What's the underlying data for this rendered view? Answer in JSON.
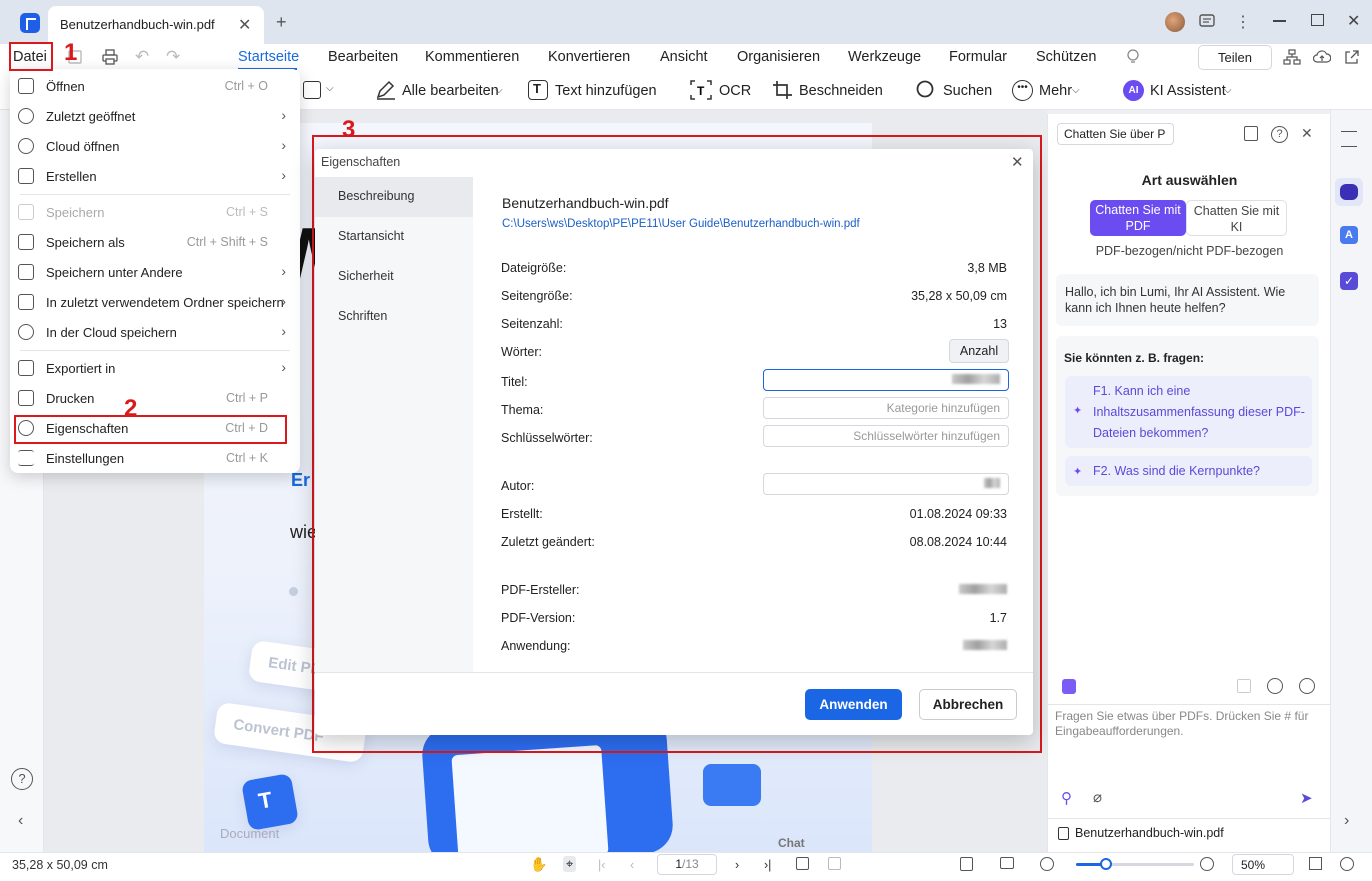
{
  "titlebar": {
    "tab_title": "Benutzerhandbuch-win.pdf",
    "close": "✕",
    "new_tab": "+"
  },
  "menubar": {
    "file_label": "Datei",
    "tabs": [
      "Startseite",
      "Bearbeiten",
      "Kommentieren",
      "Konvertieren",
      "Ansicht",
      "Organisieren",
      "Werkzeuge",
      "Formular",
      "Schützen"
    ],
    "share_label": "Teilen"
  },
  "toolbar": {
    "edit_all": "Alle bearbeiten",
    "add_text": "Text hinzufügen",
    "ocr": "OCR",
    "crop": "Beschneiden",
    "search": "Suchen",
    "more": "Mehr",
    "ai_badge": "AI",
    "ai_assistant": "KI Assistent"
  },
  "file_menu": {
    "items": [
      {
        "label": "Öffnen",
        "shortcut": "Ctrl + O",
        "arrow": ""
      },
      {
        "label": "Zuletzt geöffnet",
        "shortcut": "",
        "arrow": "›"
      },
      {
        "label": "Cloud öffnen",
        "shortcut": "",
        "arrow": "›"
      },
      {
        "label": "Erstellen",
        "shortcut": "",
        "arrow": "›"
      },
      {
        "label": "Speichern",
        "shortcut": "Ctrl + S",
        "arrow": ""
      },
      {
        "label": "Speichern als",
        "shortcut": "Ctrl + Shift + S",
        "arrow": ""
      },
      {
        "label": "Speichern unter Andere",
        "shortcut": "",
        "arrow": "›"
      },
      {
        "label": "In zuletzt verwendetem Ordner speichern",
        "shortcut": "",
        "arrow": "›"
      },
      {
        "label": "In der Cloud speichern",
        "shortcut": "",
        "arrow": "›"
      },
      {
        "label": "Exportiert in",
        "shortcut": "",
        "arrow": "›"
      },
      {
        "label": "Drucken",
        "shortcut": "Ctrl + P",
        "arrow": ""
      },
      {
        "label": "Eigenschaften",
        "shortcut": "Ctrl + D",
        "arrow": ""
      },
      {
        "label": "Einstellungen",
        "shortcut": "Ctrl + K",
        "arrow": ""
      }
    ]
  },
  "annotations": {
    "n1": "1",
    "n2": "2",
    "n3": "3"
  },
  "page_bg": {
    "headline_letter": "W",
    "line1": "Er",
    "line2": "wie",
    "card1": "Edit PDF",
    "card2": "Convert PDF",
    "doc_label": "Document",
    "chat_label": "Chat"
  },
  "dialog": {
    "title": "Eigenschaften",
    "close": "✕",
    "tabs": [
      "Beschreibung",
      "Startansicht",
      "Sicherheit",
      "Schriften"
    ],
    "filename": "Benutzerhandbuch-win.pdf",
    "path": "C:\\Users\\ws\\Desktop\\PE\\PE11\\User Guide\\Benutzerhandbuch-win.pdf",
    "rows": {
      "size_label": "Dateigröße:",
      "size_value": "3,8 MB",
      "pagesize_label": "Seitengröße:",
      "pagesize_value": "35,28 x 50,09 cm",
      "pages_label": "Seitenzahl:",
      "pages_value": "13",
      "words_label": "Wörter:",
      "words_button": "Anzahl",
      "title_label": "Titel:",
      "subject_label": "Thema:",
      "subject_placeholder": "Kategorie hinzufügen",
      "keywords_label": "Schlüsselwörter:",
      "keywords_placeholder": "Schlüsselwörter hinzufügen",
      "author_label": "Autor:",
      "created_label": "Erstellt:",
      "created_value": "01.08.2024 09:33",
      "modified_label": "Zuletzt geändert:",
      "modified_value": "08.08.2024 10:44",
      "producer_label": "PDF-Ersteller:",
      "version_label": "PDF-Version:",
      "version_value": "1.7",
      "app_label": "Anwendung:"
    },
    "apply": "Anwenden",
    "cancel": "Abbrechen"
  },
  "ai_panel": {
    "dropdown": "Chatten Sie über P",
    "heading": "Art auswählen",
    "seg_pdf": "Chatten Sie mit PDF",
    "seg_ai": "Chatten Sie mit KI",
    "subtitle": "PDF-bezogen/nicht PDF-bezogen",
    "greeting": "Hallo, ich bin Lumi, Ihr AI Assistent. Wie kann ich Ihnen heute helfen?",
    "suggest_heading": "Sie könnten z. B. fragen:",
    "q1": "F1. Kann ich eine Inhaltszusammenfassung dieser PDF-Dateien bekommen?",
    "q2": "F2. Was sind die Kernpunkte?",
    "input_placeholder": "Fragen Sie etwas über PDFs. Drücken Sie # für Eingabeaufforderungen.",
    "file_chip": "Benutzerhandbuch-win.pdf"
  },
  "statusbar": {
    "dimensions": "35,28 x 50,09 cm",
    "page_current": "1",
    "page_total": "/13",
    "zoom": "50%"
  },
  "colors": {
    "accent": "#1a6be0",
    "annotation_red": "#d9191c",
    "primary_button": "#1b66e4",
    "ai_purple": "#6a4cf0"
  }
}
